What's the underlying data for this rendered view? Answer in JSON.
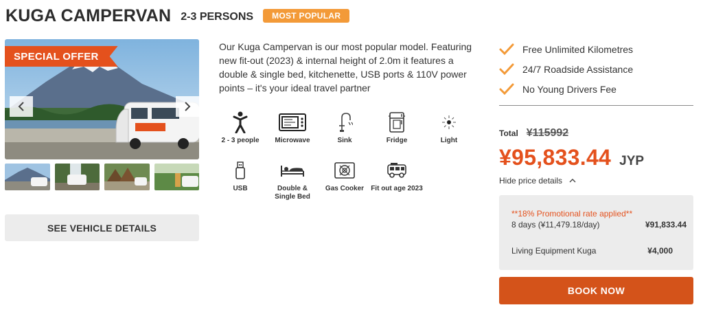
{
  "header": {
    "title": "KUGA CAMPERVAN",
    "subtitle": "2-3 PERSONS",
    "badge": "MOST POPULAR"
  },
  "gallery": {
    "offer_label": "SPECIAL OFFER",
    "prev_icon": "chevron-left-icon",
    "next_icon": "chevron-right-icon",
    "thumbnail_count": 4
  },
  "see_details_label": "SEE VEHICLE DETAILS",
  "description": "Our Kuga Campervan is our most popular model. Featuring new fit-out (2023) & internal height of 2.0m it features a double & single bed, kitchenette, USB ports & 110V power points – it's your ideal travel partner",
  "features": [
    {
      "icon": "person-icon",
      "label": "2 - 3 people"
    },
    {
      "icon": "microwave-icon",
      "label": "Microwave"
    },
    {
      "icon": "sink-icon",
      "label": "Sink"
    },
    {
      "icon": "fridge-icon",
      "label": "Fridge"
    },
    {
      "icon": "light-icon",
      "label": "Light"
    },
    {
      "icon": "usb-icon",
      "label": "USB"
    },
    {
      "icon": "bed-icon",
      "label": "Double & Single Bed"
    },
    {
      "icon": "gas-cooker-icon",
      "label": "Gas Cooker"
    },
    {
      "icon": "campervan-icon",
      "label": "Fit out age 2023"
    }
  ],
  "benefits": [
    "Free Unlimited Kilometres",
    "24/7 Roadside Assistance",
    "No Young Drivers Fee"
  ],
  "pricing": {
    "total_label": "Total",
    "old_price": "¥115992",
    "price": "¥95,833.44",
    "currency": "JYP",
    "toggle_label": "Hide price details",
    "promo": "**18% Promotional rate applied**",
    "lines": [
      {
        "label": "8 days (¥11,479.18/day)",
        "value": "¥91,833.44"
      },
      {
        "label": "Living Equipment Kuga",
        "value": "¥4,000"
      }
    ]
  },
  "book_label": "BOOK NOW",
  "colors": {
    "accent": "#e4511d",
    "badge": "#f39a38",
    "check": "#f39a38",
    "button_gray": "#ececec"
  }
}
